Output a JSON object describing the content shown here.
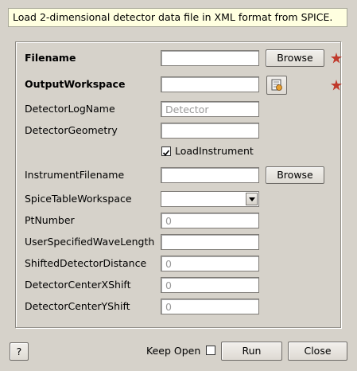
{
  "description": "Load 2-dimensional detector data file in XML format from SPICE.",
  "properties": {
    "filename": {
      "label": "Filename",
      "value": "",
      "browse": "Browse"
    },
    "output_workspace": {
      "label": "OutputWorkspace",
      "value": ""
    },
    "detector_log_name": {
      "label": "DetectorLogName",
      "placeholder": "Detector"
    },
    "detector_geometry": {
      "label": "DetectorGeometry",
      "value": ""
    },
    "load_instrument": {
      "label": "LoadInstrument",
      "checked": true
    },
    "instrument_filename": {
      "label": "InstrumentFilename",
      "value": "",
      "browse": "Browse"
    },
    "spice_table_workspace": {
      "label": "SpiceTableWorkspace",
      "value": ""
    },
    "pt_number": {
      "label": "PtNumber",
      "placeholder": "0"
    },
    "user_specified_wavelength": {
      "label": "UserSpecifiedWaveLength",
      "value": ""
    },
    "shifted_detector_distance": {
      "label": "ShiftedDetectorDistance",
      "placeholder": "0"
    },
    "detector_center_x_shift": {
      "label": "DetectorCenterXShift",
      "placeholder": "0"
    },
    "detector_center_y_shift": {
      "label": "DetectorCenterYShift",
      "placeholder": "0"
    }
  },
  "footer": {
    "help_label": "?",
    "keep_open_label": "Keep Open",
    "keep_open_checked": false,
    "run_label": "Run",
    "close_label": "Close"
  },
  "colors": {
    "background": "#d6d2ca",
    "description_bg": "#ffffe0",
    "required_star": "#c0392b"
  }
}
